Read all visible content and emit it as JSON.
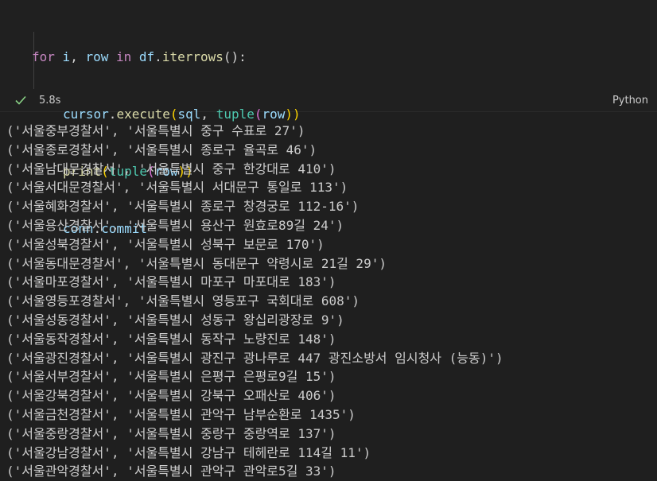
{
  "cell": {
    "code": {
      "line1": {
        "kw1": "for",
        "v1": "i",
        "c1": ", ",
        "v2": "row",
        "kw2": "in",
        "v3": "df",
        "dot": ".",
        "fn": "iterrows",
        "tail": "():"
      },
      "line2": {
        "v1": "cursor",
        "dot": ".",
        "fn": "execute",
        "op": "(",
        "v2": "sql",
        "c1": ", ",
        "b": "tuple",
        "op2": "(",
        "v3": "row",
        "cl": "))"
      },
      "line3": {
        "fn": "print",
        "op": "(",
        "b": "tuple",
        "op2": "(",
        "v": "row",
        "cl": "))"
      },
      "line4": {
        "v1": "conn",
        "dot": ".",
        "v2": "commit"
      }
    },
    "status": {
      "check_icon": "check-icon",
      "time": "5.8s",
      "language": "Python"
    }
  },
  "output": [
    "('서울중부경찰서', '서울특별시 중구 수표로 27')",
    "('서울종로경찰서', '서울특별시 종로구 율곡로 46')",
    "('서울남대문경찰서', '서울특별시 중구 한강대로 410')",
    "('서울서대문경찰서', '서울특별시 서대문구 통일로 113')",
    "('서울혜화경찰서', '서울특별시 종로구 창경궁로 112-16')",
    "('서울용산경찰서', '서울특별시 용산구 원효로89길 24')",
    "('서울성북경찰서', '서울특별시 성북구 보문로 170')",
    "('서울동대문경찰서', '서울특별시 동대문구 약령시로 21길 29')",
    "('서울마포경찰서', '서울특별시 마포구 마포대로 183')",
    "('서울영등포경찰서', '서울특별시 영등포구 국회대로 608')",
    "('서울성동경찰서', '서울특별시 성동구 왕십리광장로 9')",
    "('서울동작경찰서', '서울특별시 동작구 노량진로 148')",
    "('서울광진경찰서', '서울특별시 광진구 광나루로 447 광진소방서 임시청사 (능동)')",
    "('서울서부경찰서', '서울특별시 은평구 은평로9길 15')",
    "('서울강북경찰서', '서울특별시 강북구 오패산로 406')",
    "('서울금천경찰서', '서울특별시 관악구 남부순환로 1435')",
    "('서울중랑경찰서', '서울특별시 중랑구 중랑역로 137')",
    "('서울강남경찰서', '서울특별시 강남구 테헤란로 114길 11')",
    "('서울관악경찰서', '서울특별시 관악구 관악로5길 33')"
  ]
}
